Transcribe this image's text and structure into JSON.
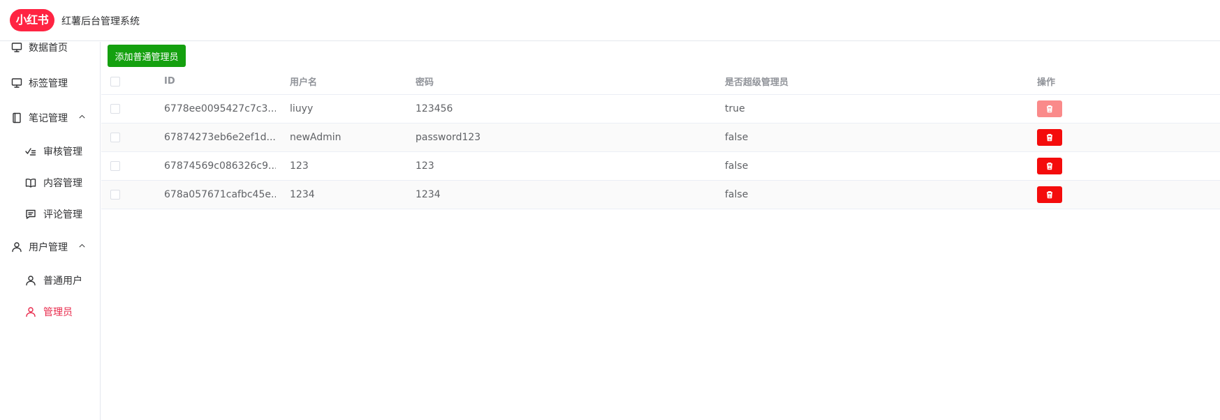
{
  "header": {
    "logo_text": "小红书",
    "app_title": "红薯后台管理系统"
  },
  "sidebar": {
    "items": [
      {
        "label": "数据首页",
        "icon": "monitor-icon"
      },
      {
        "label": "标签管理",
        "icon": "monitor-icon"
      },
      {
        "label": "笔记管理",
        "icon": "notebook-icon",
        "chevron": "^"
      },
      {
        "label": "审核管理",
        "icon": "check-list-icon"
      },
      {
        "label": "内容管理",
        "icon": "book-icon"
      },
      {
        "label": "评论管理",
        "icon": "comment-icon"
      },
      {
        "label": "用户管理",
        "icon": "user-icon",
        "chevron": "^"
      },
      {
        "label": "普通用户",
        "icon": "user-icon"
      },
      {
        "label": "管理员",
        "icon": "user-icon",
        "active": true
      }
    ]
  },
  "main": {
    "add_button_label": "添加普通管理员",
    "table": {
      "columns": [
        "ID",
        "用户名",
        "密码",
        "是否超级管理员",
        "操作"
      ],
      "rows": [
        {
          "id": "6778ee0095427c7c3...",
          "username": "liuyy",
          "password": "123456",
          "is_super": "true",
          "delete_disabled": true
        },
        {
          "id": "67874273eb6e2ef1d...",
          "username": "newAdmin",
          "password": "password123",
          "is_super": "false",
          "delete_disabled": false
        },
        {
          "id": "67874569c086326c9...",
          "username": "123",
          "password": "123",
          "is_super": "false",
          "delete_disabled": false
        },
        {
          "id": "678a057671cafbc45e...",
          "username": "1234",
          "password": "1234",
          "is_super": "false",
          "delete_disabled": false
        }
      ]
    }
  },
  "colors": {
    "brand": "#ff2442",
    "active_menu": "#e8294b",
    "add_button": "#14a00f",
    "delete_button": "#f40c0c",
    "delete_button_disabled": "#fa8a8a"
  }
}
